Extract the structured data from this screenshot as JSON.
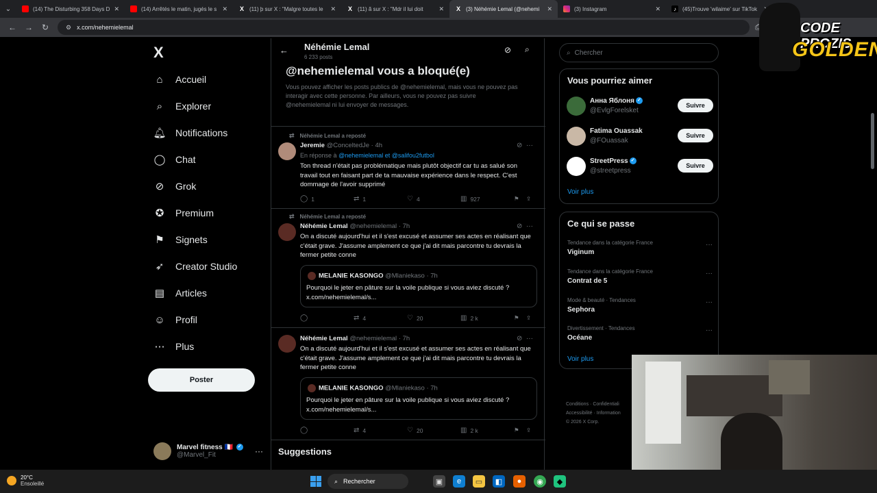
{
  "browser": {
    "tabs": [
      {
        "title": "(14) The Disturbing 358 Days D",
        "icon": "youtube-icon",
        "active": false
      },
      {
        "title": "(14) Arrêtés le matin, jugés le s",
        "icon": "youtube-icon",
        "active": false
      },
      {
        "title": "(11) þ sur X : \"Malgre toutes le",
        "icon": "x-logo-icon",
        "active": false
      },
      {
        "title": "(11) ã sur X : \"Mdr il lui doit",
        "icon": "x-logo-icon",
        "active": false
      },
      {
        "title": "(3) Néhémie Lemal (@nehemi",
        "icon": "x-logo-icon",
        "active": true
      },
      {
        "title": "(3) Instagram",
        "icon": "instagram-icon",
        "active": false
      },
      {
        "title": "(45)Trouve 'wilaime' sur TikTok",
        "icon": "tiktok-icon",
        "active": false
      }
    ],
    "url": "x.com/nehemielemal"
  },
  "sidebar": {
    "logo": "X",
    "items": [
      {
        "label": "Accueil",
        "icon": "home-icon",
        "glyph": "⌂"
      },
      {
        "label": "Explorer",
        "icon": "search-icon",
        "glyph": "⌕"
      },
      {
        "label": "Notifications",
        "icon": "bell-icon",
        "glyph": "🔔︎"
      },
      {
        "label": "Chat",
        "icon": "chat-icon",
        "glyph": "◯"
      },
      {
        "label": "Grok",
        "icon": "grok-icon",
        "glyph": "⊘"
      },
      {
        "label": "Premium",
        "icon": "premium-icon",
        "glyph": "✪"
      },
      {
        "label": "Signets",
        "icon": "bookmark-icon",
        "glyph": "⚑"
      },
      {
        "label": "Creator Studio",
        "icon": "rocket-icon",
        "glyph": "➶"
      },
      {
        "label": "Articles",
        "icon": "article-icon",
        "glyph": "▤"
      },
      {
        "label": "Profil",
        "icon": "user-icon",
        "glyph": "☺"
      },
      {
        "label": "Plus",
        "icon": "more-circle-icon",
        "glyph": "⋯"
      }
    ],
    "post_label": "Poster",
    "account": {
      "name": "Marvel fitness",
      "flag": "🇫🇷",
      "handle": "@Marvel_Fit"
    }
  },
  "header": {
    "name": "Néhémie Lemal",
    "post_count": "6 233 posts"
  },
  "blocked": {
    "title": "@nehemielemal vous a bloqué(e)",
    "text": "Vous pouvez afficher les posts publics de @nehemielemal, mais vous ne pouvez pas interagir avec cette personne. Par ailleurs, vous ne pouvez pas suivre @nehemielemal ni lui envoyer de messages."
  },
  "tweets": [
    {
      "repost_label": "Néhémie Lemal a reposté",
      "name": "Jeremie",
      "meta": "@ConceltedJe · 4h",
      "reply_prefix": "En réponse à",
      "reply_mentions": "@nehemielemal  et  @salifou2futbol",
      "text": "Ton thread n'était pas problématique mais plutôt objectif car tu as salué son travail tout en faisant part de ta mauvaise expérience dans le respect. C'est dommage de l'avoir supprimé",
      "replies": "1",
      "reposts": "1",
      "likes": "4",
      "views": "927",
      "avatar_color": "#b08b7a"
    },
    {
      "repost_label": "Néhémie Lemal a reposté",
      "name": "Néhémie Lemal",
      "meta": "@nehemielemal · 7h",
      "text": "On a discuté aujourd'hui et il s'est excusé et assumer ses actes en réalisant que c'était grave. J'assume amplement ce que j'ai dit mais parcontre tu devrais la fermer petite conne",
      "quote": {
        "name": "MELANIE KASONGO",
        "meta": "@Mlaniekaso · 7h",
        "text": "Pourquoi le jeter en pâture sur la voile publique si vous aviez discuté ? x.com/nehemielemal/s..."
      },
      "replies": "",
      "reposts": "4",
      "likes": "20",
      "views": "2 k",
      "avatar_color": "#5a2b24"
    },
    {
      "name": "Néhémie Lemal",
      "meta": "@nehemielemal · 7h",
      "text": "On a discuté aujourd'hui et il s'est excusé et assumer ses actes en réalisant que c'était grave. J'assume amplement ce que j'ai dit mais parcontre tu devrais la fermer petite conne",
      "quote": {
        "name": "MELANIE KASONGO",
        "meta": "@Mlaniekaso · 7h",
        "text": "Pourquoi le jeter en pâture sur la voile publique si vous aviez discuté ? x.com/nehemielemal/s..."
      },
      "replies": "",
      "reposts": "4",
      "likes": "20",
      "views": "2 k",
      "avatar_color": "#5a2b24"
    }
  ],
  "suggestions_title": "Suggestions",
  "right": {
    "search_placeholder": "Chercher",
    "who_title": "Vous pourriez aimer",
    "who": [
      {
        "name": "Анна Яблоня",
        "handle": "@EvlgForelsket",
        "verified": true,
        "avatar_color": "#3b6b3a"
      },
      {
        "name": "Fatima Ouassak",
        "handle": "@FOuassak",
        "verified": false,
        "avatar_color": "#c9b8a6"
      },
      {
        "name": "StreetPress",
        "handle": "@streetpress",
        "verified": true,
        "avatar_color": "#ffffff"
      }
    ],
    "follow_label": "Suivre",
    "see_more": "Voir plus",
    "trends_title": "Ce qui se passe",
    "trends": [
      {
        "category": "Tendance dans la catégorie France",
        "name": "Viginum"
      },
      {
        "category": "Tendance dans la catégorie France",
        "name": "Contrat de 5"
      },
      {
        "category": "Mode & beauté · Tendances",
        "name": "Sephora"
      },
      {
        "category": "Divertissement · Tendances",
        "name": "Océane"
      }
    ],
    "footer": [
      "Conditions",
      "Confidentiali",
      "Accessibilité",
      "Information",
      "© 2026 X Corp."
    ]
  },
  "overlay": {
    "line1": "CODE PROZIS",
    "line2": "GOLDENG"
  },
  "taskbar": {
    "temp": "20°C",
    "weather": "Ensoleillé",
    "search": "Rechercher"
  },
  "colors": {
    "accent": "#1d9bf0",
    "background": "#000000",
    "border": "#2f3336",
    "muted": "#71767b"
  }
}
